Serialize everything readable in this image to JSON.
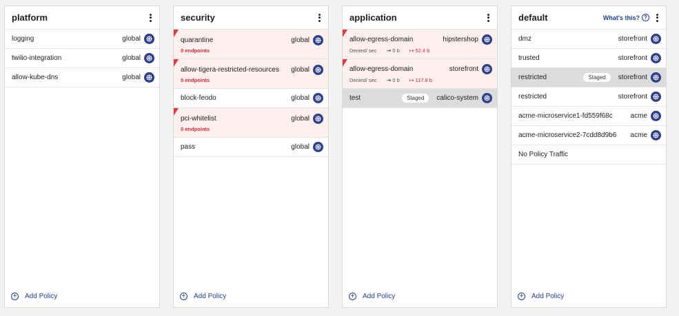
{
  "tiers": [
    {
      "title": "platform",
      "policies": [
        {
          "name": "logging",
          "namespace": "global"
        },
        {
          "name": "twilio-integration",
          "namespace": "global"
        },
        {
          "name": "allow-kube-dns",
          "namespace": "global"
        }
      ],
      "add_label": "Add Policy"
    },
    {
      "title": "security",
      "policies": [
        {
          "name": "quarantine",
          "namespace": "global",
          "warning": "0 endpoints"
        },
        {
          "name": "allow-tigera-restricted-resources",
          "namespace": "global",
          "warning": "0 endpoints"
        },
        {
          "name": "block-feodo",
          "namespace": "global"
        },
        {
          "name": "pci-whitelist",
          "namespace": "global",
          "warning": "0 endpoints"
        },
        {
          "name": "pass",
          "namespace": "global"
        }
      ],
      "add_label": "Add Policy"
    },
    {
      "title": "application",
      "policies": [
        {
          "name": "allow-egress-domain",
          "namespace": "hipstershop",
          "denied_label": "Denied/ sec",
          "in_rate": "0 b",
          "out_rate": "52.4 b"
        },
        {
          "name": "allow-egress-domain",
          "namespace": "storefront",
          "denied_label": "Denied/ sec",
          "in_rate": "0 b",
          "out_rate": "117.8 b"
        },
        {
          "name": "test",
          "namespace": "calico-system",
          "staged": "Staged"
        }
      ],
      "add_label": "Add Policy"
    },
    {
      "title": "default",
      "whats_this": "What's this?",
      "policies": [
        {
          "name": "dmz",
          "namespace": "storefront"
        },
        {
          "name": "trusted",
          "namespace": "storefront"
        },
        {
          "name": "restricted",
          "namespace": "storefront",
          "staged": "Staged"
        },
        {
          "name": "restricted",
          "namespace": "storefront"
        },
        {
          "name": "acme-microservice1-fd559f68c",
          "namespace": "acme"
        },
        {
          "name": "acme-microservice2-7cdd8d9b6",
          "namespace": "acme"
        },
        {
          "name": "No Policy Traffic"
        }
      ],
      "add_label": "Add Policy"
    }
  ],
  "colors": {
    "accent": "#1f3d8f",
    "alert": "#e0262b",
    "alert_bg": "#fcefee",
    "staged_bg": "#dcdcdc",
    "namespace_icon": "#2c3e8c"
  },
  "icons": {
    "namespace": "kubernetes-helm-icon",
    "menu": "kebab-menu-icon",
    "add": "plus-circle-icon",
    "help": "question-circle-icon",
    "inbound": "arrow-in-icon",
    "outbound": "arrow-out-icon"
  }
}
